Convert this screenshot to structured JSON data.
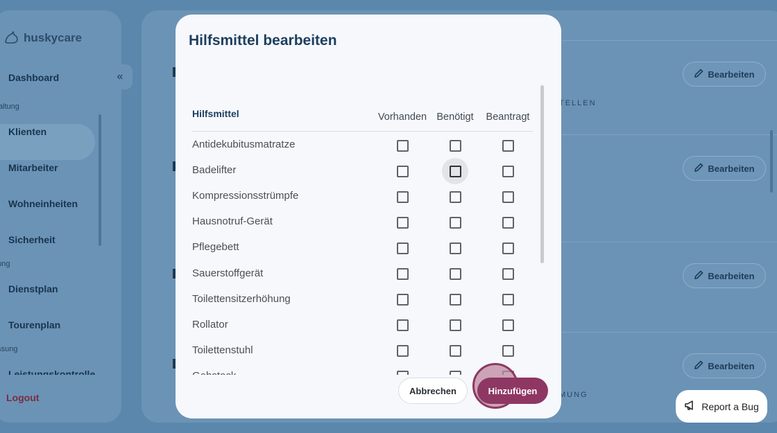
{
  "brand": {
    "name_part1": "husky",
    "name_part2": "care"
  },
  "sidebar": {
    "items": [
      {
        "label": "Dashboard"
      },
      {
        "label": "Klienten"
      },
      {
        "label": "Mitarbeiter"
      },
      {
        "label": "Wohneinheiten"
      },
      {
        "label": "Sicherheit"
      },
      {
        "label": "Dienstplan"
      },
      {
        "label": "Tourenplan"
      },
      {
        "label": "Leistungskontrolle"
      }
    ],
    "sections": [
      "waltung",
      "nung",
      "assung"
    ],
    "logout_label": "Logout"
  },
  "main": {
    "edit_buttons": [
      "Bearbeiten",
      "Bearbeiten",
      "Bearbeiten",
      "Bearbeiten"
    ],
    "caption_1": "TELLEN",
    "caption_2": "MUNG"
  },
  "modal": {
    "title": "Hilfsmittel bearbeiten",
    "table": {
      "name_header": "Hilfsmittel",
      "columns": [
        "Vorhanden",
        "Benötigt",
        "Beantragt"
      ],
      "rows": [
        {
          "label": "Antidekubitusmatratze"
        },
        {
          "label": "Badelifter"
        },
        {
          "label": "Kompressionsstrümpfe"
        },
        {
          "label": "Hausnotruf-Gerät"
        },
        {
          "label": "Pflegebett"
        },
        {
          "label": "Sauerstoffgerät"
        },
        {
          "label": "Toilettensitzerhöhung"
        },
        {
          "label": "Rollator"
        },
        {
          "label": "Toilettenstuhl"
        },
        {
          "label": "Gehstock"
        }
      ]
    },
    "cancel_label": "Abbrechen",
    "add_label": "Hinzufügen"
  },
  "report_bug_label": "Report a Bug"
}
